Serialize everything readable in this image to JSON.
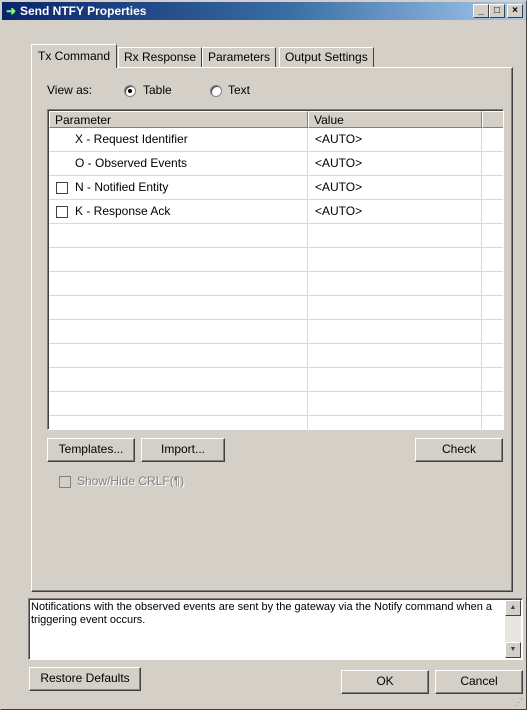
{
  "window": {
    "title": "Send NTFY Properties",
    "title_icon": "green-arrow-icon",
    "controls": {
      "minimize": "_",
      "maximize": "□",
      "close": "×"
    }
  },
  "tabs": [
    {
      "label": "Tx Command",
      "active": true
    },
    {
      "label": "Rx Response",
      "active": false
    },
    {
      "label": "Parameters",
      "active": false
    },
    {
      "label": "Output Settings",
      "active": false
    }
  ],
  "view_as": {
    "label": "View as:",
    "options": [
      {
        "label": "Table",
        "selected": true
      },
      {
        "label": "Text",
        "selected": false
      }
    ]
  },
  "grid": {
    "columns": [
      "Parameter",
      "Value"
    ],
    "rows": [
      {
        "parameter": "X - Request Identifier",
        "value": "<AUTO>",
        "has_checkbox": false,
        "checked": false
      },
      {
        "parameter": "O - Observed Events",
        "value": "<AUTO>",
        "has_checkbox": false,
        "checked": false
      },
      {
        "parameter": "N - Notified Entity",
        "value": "<AUTO>",
        "has_checkbox": true,
        "checked": false
      },
      {
        "parameter": "K - Response Ack",
        "value": "<AUTO>",
        "has_checkbox": true,
        "checked": false
      }
    ]
  },
  "buttons": {
    "templates": "Templates...",
    "import": "Import...",
    "check": "Check",
    "restore_defaults": "Restore Defaults",
    "ok": "OK",
    "cancel": "Cancel"
  },
  "show_hide_crlf": {
    "label": "Show/Hide CRLF(¶)",
    "checked": false,
    "enabled": false
  },
  "description": "Notifications with the observed events are sent by the gateway via the Notify command when a triggering event occurs.",
  "colors": {
    "title_gradient_start": "#0a246a",
    "title_gradient_end": "#a6caf0",
    "face": "#d4d0c8"
  }
}
